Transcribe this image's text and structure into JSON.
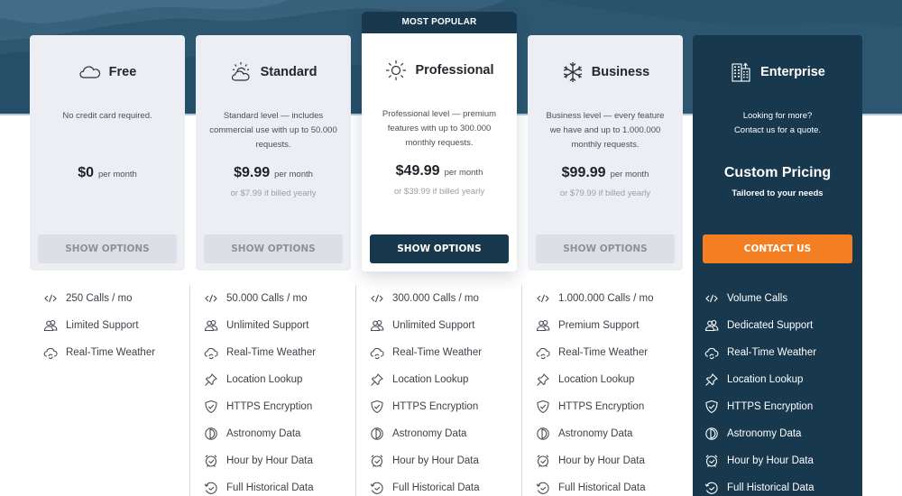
{
  "plans": [
    {
      "id": "free",
      "name": "Free",
      "icon": "cloud-icon",
      "description": "No credit card required.",
      "price": "$0",
      "period": "per month",
      "yearly": "",
      "button": "SHOW OPTIONS",
      "features": [
        {
          "icon": "code-icon",
          "label": "250 Calls / mo"
        },
        {
          "icon": "users-icon",
          "label": "Limited Support"
        },
        {
          "icon": "cloud-sync-icon",
          "label": "Real-Time Weather"
        }
      ]
    },
    {
      "id": "standard",
      "name": "Standard",
      "icon": "sun-cloud-icon",
      "description": "Standard level — includes commercial use with up to 50.000 requests.",
      "price": "$9.99",
      "period": "per month",
      "yearly": "or $7.99 if billed yearly",
      "button": "SHOW OPTIONS",
      "features": [
        {
          "icon": "code-icon",
          "label": "50.000 Calls / mo"
        },
        {
          "icon": "users-icon",
          "label": "Unlimited Support"
        },
        {
          "icon": "cloud-sync-icon",
          "label": "Real-Time Weather"
        },
        {
          "icon": "pin-icon",
          "label": "Location Lookup"
        },
        {
          "icon": "shield-check-icon",
          "label": "HTTPS Encryption"
        },
        {
          "icon": "moon-phase-icon",
          "label": "Astronomy Data"
        },
        {
          "icon": "alarm-clock-icon",
          "label": "Hour by Hour Data"
        },
        {
          "icon": "history-icon",
          "label": "Full Historical Data"
        }
      ]
    },
    {
      "id": "professional",
      "name": "Professional",
      "icon": "sun-icon",
      "badge": "MOST POPULAR",
      "description": "Professional level — premium features with up to 300.000 monthly requests.",
      "price": "$49.99",
      "period": "per month",
      "yearly": "or $39.99 if billed yearly",
      "button": "SHOW OPTIONS",
      "features": [
        {
          "icon": "code-icon",
          "label": "300.000 Calls / mo"
        },
        {
          "icon": "users-icon",
          "label": "Unlimited Support"
        },
        {
          "icon": "cloud-sync-icon",
          "label": "Real-Time Weather"
        },
        {
          "icon": "pin-icon",
          "label": "Location Lookup"
        },
        {
          "icon": "shield-check-icon",
          "label": "HTTPS Encryption"
        },
        {
          "icon": "moon-phase-icon",
          "label": "Astronomy Data"
        },
        {
          "icon": "alarm-clock-icon",
          "label": "Hour by Hour Data"
        },
        {
          "icon": "history-icon",
          "label": "Full Historical Data"
        }
      ]
    },
    {
      "id": "business",
      "name": "Business",
      "icon": "snowflake-icon",
      "description": "Business level — every feature we have and up to 1.000.000 monthly requests.",
      "price": "$99.99",
      "period": "per month",
      "yearly": "or $79.99 if billed yearly",
      "button": "SHOW OPTIONS",
      "features": [
        {
          "icon": "code-icon",
          "label": "1.000.000 Calls / mo"
        },
        {
          "icon": "users-icon",
          "label": "Premium Support"
        },
        {
          "icon": "cloud-sync-icon",
          "label": "Real-Time Weather"
        },
        {
          "icon": "pin-icon",
          "label": "Location Lookup"
        },
        {
          "icon": "shield-check-icon",
          "label": "HTTPS Encryption"
        },
        {
          "icon": "moon-phase-icon",
          "label": "Astronomy Data"
        },
        {
          "icon": "alarm-clock-icon",
          "label": "Hour by Hour Data"
        },
        {
          "icon": "history-icon",
          "label": "Full Historical Data"
        }
      ]
    },
    {
      "id": "enterprise",
      "name": "Enterprise",
      "icon": "building-icon",
      "description_line1": "Looking for more?",
      "description_line2": "Contact us for a quote.",
      "custom_title": "Custom Pricing",
      "custom_sub": "Tailored to your needs",
      "button": "CONTACT US",
      "features": [
        {
          "icon": "code-icon",
          "label": "Volume Calls"
        },
        {
          "icon": "users-icon",
          "label": "Dedicated Support"
        },
        {
          "icon": "cloud-sync-icon",
          "label": "Real-Time Weather"
        },
        {
          "icon": "pin-icon",
          "label": "Location Lookup"
        },
        {
          "icon": "shield-check-icon",
          "label": "HTTPS Encryption"
        },
        {
          "icon": "moon-phase-icon",
          "label": "Astronomy Data"
        },
        {
          "icon": "alarm-clock-icon",
          "label": "Hour by Hour Data"
        },
        {
          "icon": "history-icon",
          "label": "Full Historical Data"
        }
      ]
    }
  ],
  "colors": {
    "hero": "#2d5670",
    "navy": "#17384d",
    "card": "#eceef3",
    "accent_orange": "#f47f22",
    "ghost_button": "#dcdfe6"
  }
}
